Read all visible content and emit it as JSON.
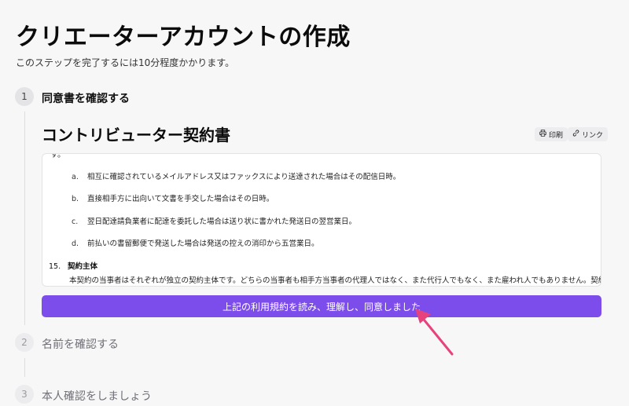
{
  "page": {
    "title": "クリエーターアカウントの作成",
    "subtitle": "このステップを完了するには10分程度かかります。"
  },
  "steps": [
    {
      "number": "1",
      "label": "同意書を確認する",
      "state": "active"
    },
    {
      "number": "2",
      "label": "名前を確認する",
      "state": "inactive"
    },
    {
      "number": "3",
      "label": "本人確認をしましょう",
      "state": "inactive"
    }
  ],
  "contract": {
    "title": "コントリビューター契約書",
    "print_label": "印刷",
    "link_label": "リンク",
    "cut_off_text": "す。",
    "clauses": [
      {
        "marker": "a.",
        "text": "相互に確認されているメイルアドレス又はファックスにより送達された場合はその配信日時。"
      },
      {
        "marker": "b.",
        "text": "直接相手方に出向いて文書を手交した場合はその日時。"
      },
      {
        "marker": "c.",
        "text": "翌日配達請負業者に配達を委託した場合は送り状に書かれた発送日の翌営業日。"
      },
      {
        "marker": "d.",
        "text": "前払いの書留郵便で発送した場合は発送の控えの消印から五営業日。"
      }
    ],
    "section_number": "15.",
    "section_title": "契約主体",
    "section_body": "本契約の当事者はそれぞれが独立の契約主体です。どちらの当事者も相手方当事者の代理人ではなく、また代行人でもなく、また雇われ人でもありません。契約のどちらの当事"
  },
  "agree_button_label": "上記の利用規約を読み、理解し、同意しました",
  "colors": {
    "accent": "#7c4dea",
    "annotation_arrow": "#e8427c",
    "background": "#f7f7f8"
  },
  "icons": {
    "print": "printer-icon",
    "link": "link-icon"
  }
}
